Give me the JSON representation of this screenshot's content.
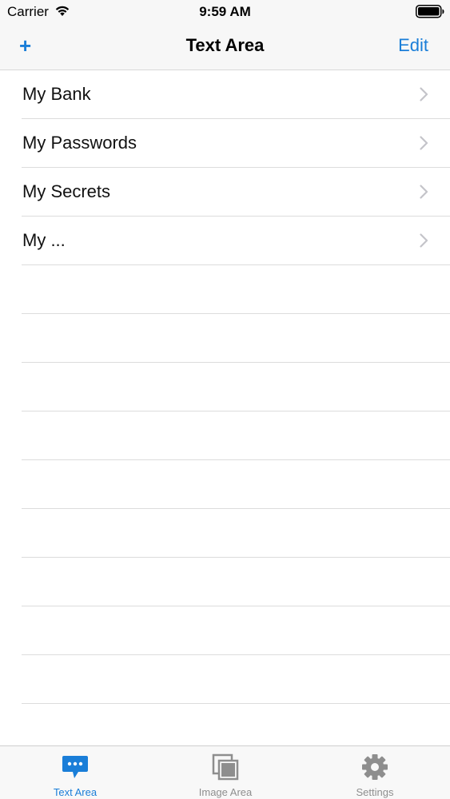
{
  "status_bar": {
    "carrier": "Carrier",
    "time": "9:59 AM"
  },
  "nav": {
    "add_label": "+",
    "title": "Text Area",
    "edit_label": "Edit"
  },
  "list": {
    "items": [
      {
        "label": "My Bank"
      },
      {
        "label": "My Passwords"
      },
      {
        "label": "My Secrets"
      },
      {
        "label": "My ..."
      }
    ]
  },
  "tab_bar": {
    "tabs": [
      {
        "label": "Text Area",
        "icon": "chat-bubble-icon",
        "active": true
      },
      {
        "label": "Image Area",
        "icon": "images-icon",
        "active": false
      },
      {
        "label": "Settings",
        "icon": "gear-icon",
        "active": false
      }
    ]
  },
  "colors": {
    "accent": "#1a7ed8",
    "inactive": "#8e8e8e"
  }
}
